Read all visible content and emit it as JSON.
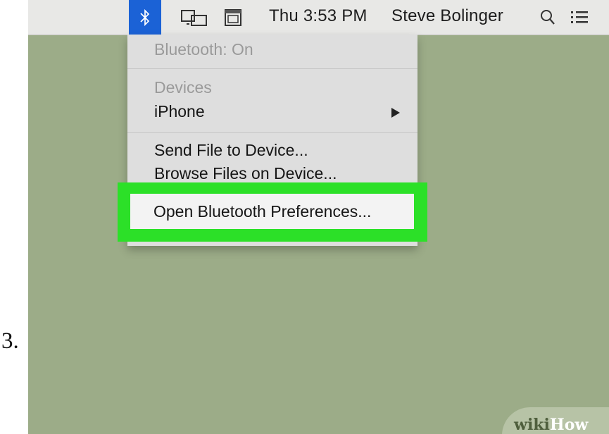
{
  "step": {
    "number": "3."
  },
  "menubar": {
    "icons": [
      "bluetooth-icon",
      "airplay-display-icon",
      "keyboard-input-menu-icon",
      "spotlight-search-icon",
      "notification-center-icon"
    ],
    "clock": "Thu 3:53 PM",
    "user": "Steve Bolinger"
  },
  "bluetooth_menu": {
    "status": "Bluetooth: On",
    "devices_header": "Devices",
    "device": "iPhone",
    "send_file": "Send File to Device...",
    "browse_files": "Browse Files on Device...",
    "open_preferences": "Open Bluetooth Preferences..."
  },
  "highlight_color": "#2ce028",
  "watermark": {
    "part1": "wiki",
    "part2": "How"
  }
}
